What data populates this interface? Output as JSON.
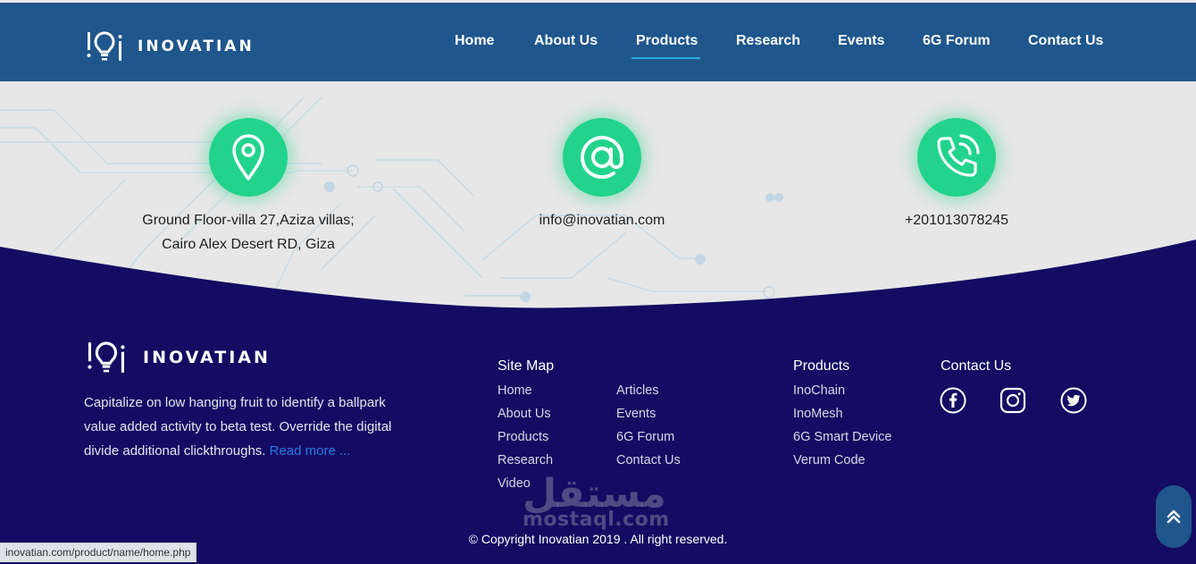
{
  "brand": {
    "name": "INOVATIAN"
  },
  "nav": {
    "items": [
      "Home",
      "About Us",
      "Products",
      "Research",
      "Events",
      "6G Forum",
      "Contact Us"
    ],
    "active": "Products"
  },
  "contact_band": {
    "address_line1": "Ground Floor-villa 27,Aziza villas;",
    "address_line2": "Cairo Alex Desert RD, Giza",
    "email": "info@inovatian.com",
    "phone": "+201013078245",
    "icons": [
      "location-pin-icon",
      "at-sign-icon",
      "phone-icon"
    ]
  },
  "footer": {
    "about_text": "Capitalize on low hanging fruit to identify a ballpark value added activity to beta test. Override the digital divide additional clickthroughs. ",
    "read_more": "Read more ...",
    "sitemap": {
      "title": "Site Map",
      "col1": [
        "Home",
        "About Us",
        "Products",
        "Research",
        "Video"
      ],
      "col2": [
        "Articles",
        "Events",
        "6G Forum",
        "Contact Us"
      ]
    },
    "products": {
      "title": "Products",
      "items": [
        "InoChain",
        "InoMesh",
        "6G Smart Device",
        "Verum Code"
      ]
    },
    "contact": {
      "title": "Contact Us",
      "social": [
        "facebook-icon",
        "instagram-icon",
        "twitter-icon"
      ]
    },
    "copyright": "© Copyright Inovatian 2019 . All right reserved."
  },
  "watermark": {
    "arabic": "مستقل",
    "latin": "mostaql.com"
  },
  "status_bar": {
    "url": "inovatian.com/product/name/home.php"
  },
  "colors": {
    "header_bg": "#1f568c",
    "footer_bg": "#130c62",
    "accent_green": "#22d38c",
    "link_blue": "#2b78e4",
    "underline": "#2fa9e1"
  }
}
